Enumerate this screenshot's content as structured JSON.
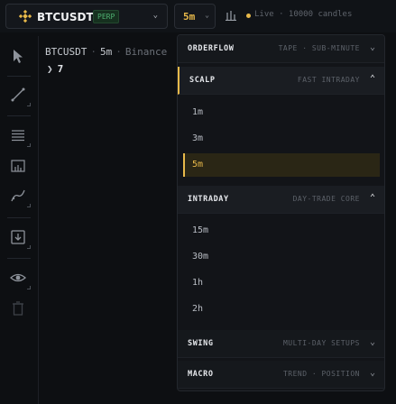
{
  "header": {
    "symbol": "BTCUSDT",
    "badge": "PERP",
    "timeframe": "5m",
    "status": "Live · 10000 candles",
    "colors": {
      "accent": "#e8b94a",
      "badge": "#4fb072"
    },
    "icons": [
      "exchange-logo-icon",
      "chevron-down-icon",
      "bar-chart-icon"
    ]
  },
  "toolbar": {
    "tools": [
      "cursor-icon",
      "trend-line-icon",
      "horizontal-lines-icon",
      "measure-icon",
      "curve-line-icon",
      "download-icon",
      "eye-icon",
      "trash-icon"
    ]
  },
  "legend": {
    "symbol": "BTCUSDT",
    "timeframe": "5m",
    "exchange": "Binance",
    "indicator_count": "7"
  },
  "timeframe_menu": {
    "groups": [
      {
        "name": "ORDERFLOW",
        "description": "TAPE · SUB-MINUTE",
        "expanded": false,
        "items": []
      },
      {
        "name": "SCALP",
        "description": "FAST INTRADAY",
        "expanded": true,
        "items": [
          "1m",
          "3m",
          "5m"
        ],
        "selected": "5m"
      },
      {
        "name": "INTRADAY",
        "description": "DAY-TRADE CORE",
        "expanded": true,
        "items": [
          "15m",
          "30m",
          "1h",
          "2h"
        ]
      },
      {
        "name": "SWING",
        "description": "MULTI-DAY SETUPS",
        "expanded": false,
        "items": []
      },
      {
        "name": "MACRO",
        "description": "TREND · POSITION",
        "expanded": false,
        "items": []
      }
    ]
  }
}
